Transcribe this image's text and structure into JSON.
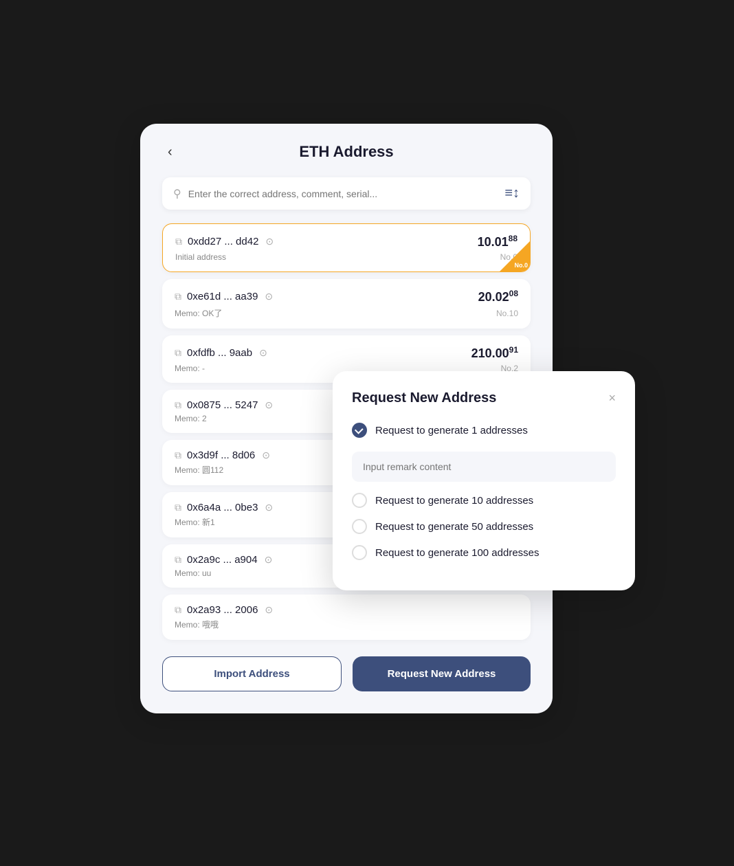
{
  "header": {
    "back_label": "‹",
    "title": "ETH Address"
  },
  "search": {
    "placeholder": "Enter the correct address, comment, serial..."
  },
  "filter_icon": "≡↕",
  "addresses": [
    {
      "address": "0xdd27 ... dd42",
      "memo": "Initial address",
      "amount_main": "10.01",
      "amount_sub": "88",
      "number": "No.0",
      "active": true
    },
    {
      "address": "0xe61d ... aa39",
      "memo": "Memo: OK了",
      "amount_main": "20.02",
      "amount_sub": "08",
      "number": "No.10",
      "active": false
    },
    {
      "address": "0xfdfb ... 9aab",
      "memo": "Memo: -",
      "amount_main": "210.00",
      "amount_sub": "91",
      "number": "No.2",
      "active": false
    },
    {
      "address": "0x0875 ... 5247",
      "memo": "Memo: 2",
      "amount_main": "",
      "amount_sub": "",
      "number": "",
      "active": false
    },
    {
      "address": "0x3d9f ... 8d06",
      "memo": "Memo: 圆112",
      "amount_main": "",
      "amount_sub": "",
      "number": "",
      "active": false
    },
    {
      "address": "0x6a4a ... 0be3",
      "memo": "Memo: 新1",
      "amount_main": "",
      "amount_sub": "",
      "number": "",
      "active": false
    },
    {
      "address": "0x2a9c ... a904",
      "memo": "Memo: uu",
      "amount_main": "",
      "amount_sub": "",
      "number": "",
      "active": false
    },
    {
      "address": "0x2a93 ... 2006",
      "memo": "Memo: 哦哦",
      "amount_main": "",
      "amount_sub": "",
      "number": "",
      "active": false
    }
  ],
  "buttons": {
    "import": "Import Address",
    "request": "Request New Address"
  },
  "modal": {
    "title": "Request New Address",
    "close_label": "×",
    "options": [
      {
        "label": "Request to generate 1 addresses",
        "checked": true
      },
      {
        "label": "Request to generate 10 addresses",
        "checked": false
      },
      {
        "label": "Request to generate 50 addresses",
        "checked": false
      },
      {
        "label": "Request to generate 100 addresses",
        "checked": false
      }
    ],
    "remark_placeholder": "Input remark content"
  },
  "corner_label": "No.0"
}
